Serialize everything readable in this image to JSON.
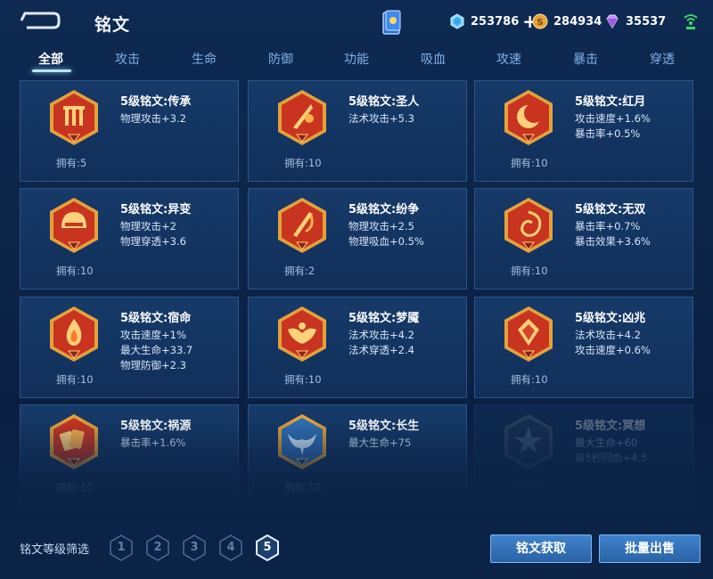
{
  "header": {
    "title": "铭文",
    "currencies": [
      {
        "icon": "diamond-icon",
        "value": "253786"
      },
      {
        "icon": "gold-coin-icon",
        "value": "284934"
      },
      {
        "icon": "gem-icon",
        "value": "35537"
      }
    ],
    "plus_label": "+"
  },
  "tabs": [
    "全部",
    "攻击",
    "生命",
    "防御",
    "功能",
    "吸血",
    "攻速",
    "暴击",
    "穿透"
  ],
  "active_tab": 0,
  "cards": [
    {
      "name": "5级铭文:传承",
      "stats": [
        "物理攻击+3.2"
      ],
      "owned": "拥有:5",
      "icon": "pillar-emblem-icon"
    },
    {
      "name": "5级铭文:圣人",
      "stats": [
        "法术攻击+5.3"
      ],
      "owned": "拥有:10",
      "icon": "quill-emblem-icon"
    },
    {
      "name": "5级铭文:红月",
      "stats": [
        "攻击速度+1.6%",
        "暴击率+0.5%"
      ],
      "owned": "拥有:10",
      "icon": "crescent-moon-emblem-icon"
    },
    {
      "name": "5级铭文:异变",
      "stats": [
        "物理攻击+2",
        "物理穿透+3.6"
      ],
      "owned": "拥有:10",
      "icon": "helmet-emblem-icon"
    },
    {
      "name": "5级铭文:纷争",
      "stats": [
        "物理攻击+2.5",
        "物理吸血+0.5%"
      ],
      "owned": "拥有:2",
      "icon": "sword-emblem-icon"
    },
    {
      "name": "5级铭文:无双",
      "stats": [
        "暴击率+0.7%",
        "暴击效果+3.6%"
      ],
      "owned": "拥有:10",
      "icon": "swirl-emblem-icon"
    },
    {
      "name": "5级铭文:宿命",
      "stats": [
        "攻击速度+1%",
        "最大生命+33.7",
        "物理防御+2.3"
      ],
      "owned": "拥有:10",
      "icon": "flame-emblem-icon"
    },
    {
      "name": "5级铭文:梦魇",
      "stats": [
        "法术攻击+4.2",
        "法术穿透+2.4"
      ],
      "owned": "拥有:10",
      "icon": "bat-emblem-icon"
    },
    {
      "name": "5级铭文:凶兆",
      "stats": [
        "法术攻击+4.2",
        "攻击速度+0.6%"
      ],
      "owned": "拥有:10",
      "icon": "gem-emblem-icon"
    },
    {
      "name": "5级铭文:祸源",
      "stats": [
        "暴击率+1.6%"
      ],
      "owned": "拥有:10",
      "icon": "cards-emblem-icon"
    },
    {
      "name": "5级铭文:长生",
      "stats": [
        "最大生命+75"
      ],
      "owned": "拥有:10",
      "icon": "whale-tail-emblem-icon"
    },
    {
      "name": "5级铭文:冥想",
      "stats": [
        "最大生命+60",
        "每5秒回血+4.5"
      ],
      "owned": "未获得",
      "icon": "star-emblem-icon",
      "locked": true
    }
  ],
  "footer": {
    "filter_label": "铭文等级筛选",
    "levels": [
      "1",
      "2",
      "3",
      "4",
      "5"
    ],
    "active_level": 4,
    "get_button": "铭文获取",
    "sell_button": "批量出售"
  },
  "colors": {
    "background": "#0c2548",
    "card_bg": "#143663",
    "emblem_red": "#c8341f",
    "emblem_gold": "#e2a23c",
    "emblem_blue": "#2f6fb3",
    "button_blue": "#3573b9"
  }
}
